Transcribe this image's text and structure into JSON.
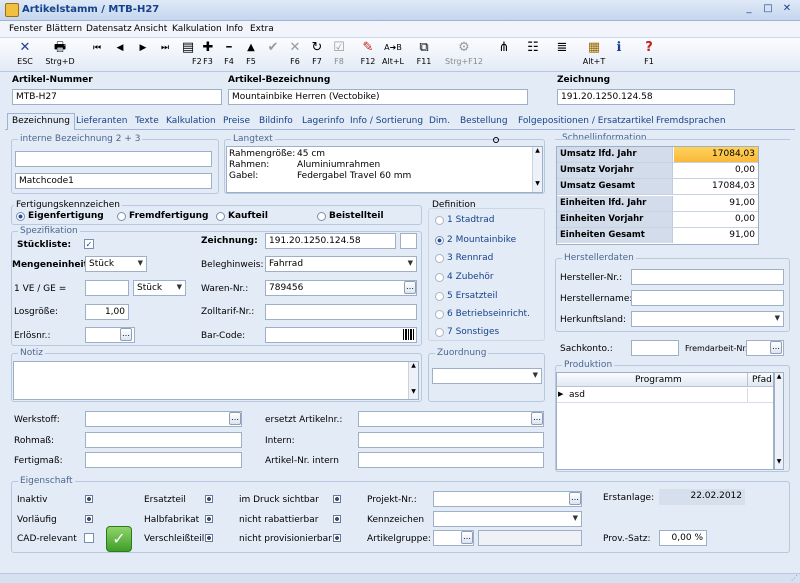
{
  "window": {
    "title": "Artikelstamm / MTB-H27",
    "buttons": [
      "_",
      "□",
      "✕"
    ]
  },
  "menu": [
    "Fenster",
    "Blättern",
    "Datensatz",
    "Ansicht",
    "Kalkulation",
    "Info",
    "Extra"
  ],
  "toolbar": [
    {
      "icon": "✕",
      "key": "ESC"
    },
    {
      "icon": "🖶",
      "key": "Strg+D"
    },
    {
      "icon": "⏮",
      "key": ""
    },
    {
      "icon": "◀",
      "key": ""
    },
    {
      "icon": "▶",
      "key": ""
    },
    {
      "icon": "⏭",
      "key": ""
    },
    {
      "icon": "▤",
      "key": "F2"
    },
    {
      "icon": "✚",
      "key": "F3"
    },
    {
      "icon": "━",
      "key": "F4"
    },
    {
      "icon": "▲",
      "key": "F5"
    },
    {
      "icon": "✔",
      "key": ""
    },
    {
      "icon": "✕",
      "key": "F6"
    },
    {
      "icon": "↻",
      "key": "F7"
    },
    {
      "icon": "☑",
      "key": "F8"
    },
    {
      "icon": "✎",
      "key": "F12"
    },
    {
      "icon": "A➜B",
      "key": "Alt+L"
    },
    {
      "icon": "⧉",
      "key": "F11"
    },
    {
      "icon": "⚙",
      "key": "Strg+F12"
    },
    {
      "icon": "⋔",
      "key": ""
    },
    {
      "icon": "☷",
      "key": ""
    },
    {
      "icon": "≣",
      "key": ""
    },
    {
      "icon": "▦",
      "key": "Alt+T"
    },
    {
      "icon": "ℹ",
      "key": ""
    },
    {
      "icon": "?",
      "key": "F1"
    }
  ],
  "header": {
    "nr_label": "Artikel-Nummer",
    "nr_value": "MTB-H27",
    "bez_label": "Artikel-Bezeichnung",
    "bez_value": "Mountainbike Herren (Vectobike)",
    "zeich_label": "Zeichnung",
    "zeich_value": "191.20.1250.124.58"
  },
  "tabs": [
    "Bezeichnung",
    "Lieferanten",
    "Texte",
    "Kalkulation",
    "Preise",
    "Bildinfo",
    "Lagerinfo",
    "Info / Sortierung",
    "Dim.",
    "Bestellung",
    "Folgepositionen / Ersatzartikel",
    "Fremdsprachen"
  ],
  "interne": {
    "title": "interne Bezeichnung 2 + 3",
    "line1": "",
    "line2": "Matchcode1"
  },
  "langtext": {
    "title": "Langtext",
    "lines": [
      {
        "k": "Rahmengröße:",
        "v": "45 cm"
      },
      {
        "k": "Rahmen:",
        "v": "Aluminiumrahmen"
      },
      {
        "k": "Gabel:",
        "v": "Federgabel Travel 60 mm"
      }
    ]
  },
  "fertigung": {
    "title": "Fertigungskennzeichen",
    "options": [
      "Eigenfertigung",
      "Fremdfertigung",
      "Kaufteil",
      "Beistellteil"
    ]
  },
  "definition": {
    "title": "Definition",
    "options": [
      "1 Stadtrad",
      "2 Mountainbike",
      "3 Rennrad",
      "4 Zubehör",
      "5 Ersatzteil",
      "6 Betriebseinricht.",
      "7 Sonstiges"
    ]
  },
  "spez": {
    "title": "Spezifikation",
    "stueckliste": "Stückliste:",
    "stueckliste_check": "✓",
    "mengeneinheit": "Mengeneinheit:",
    "mengeneinheit_value": "Stück",
    "ve": "1 VE / GE =",
    "ve_value": "",
    "ve_unit": "Stück",
    "losgroesse": "Losgröße:",
    "losgroesse_value": "1,00",
    "erloesnr": "Erlösnr.:",
    "zeichnung": "Zeichnung:",
    "zeichnung_value": "191.20.1250.124.58",
    "beleghinweis": "Beleghinweis:",
    "beleghinweis_value": "Fahrrad",
    "warennr": "Waren-Nr.:",
    "warennr_value": "789456",
    "zolltarif": "Zolltarif-Nr.:",
    "zolltarif_value": "",
    "barcode": "Bar-Code:",
    "barcode_value": ""
  },
  "notiz": {
    "title": "Notiz"
  },
  "zuordnung": {
    "title": "Zuordnung"
  },
  "lower": {
    "werkstoff": "Werkstoff:",
    "rohmass": "Rohmaß:",
    "fertigmass": "Fertigmaß:",
    "ersetzt": "ersetzt Artikelnr.:",
    "intern": "Intern:",
    "artnr_intern": "Artikel-Nr. intern"
  },
  "schnell": {
    "title": "Schnellinformation",
    "rows": [
      {
        "k": "Umsatz lfd. Jahr",
        "v": "17084,03"
      },
      {
        "k": "Umsatz Vorjahr",
        "v": "0,00"
      },
      {
        "k": "Umsatz Gesamt",
        "v": "17084,03"
      },
      {
        "k": "Einheiten lfd. Jahr",
        "v": "91,00"
      },
      {
        "k": "Einheiten Vorjahr",
        "v": "0,00"
      },
      {
        "k": "Einheiten Gesamt",
        "v": "91,00"
      }
    ]
  },
  "hersteller": {
    "title": "Herstellerdaten",
    "nr": "Hersteller-Nr.:",
    "name": "Herstellername:",
    "land": "Herkunftsland:"
  },
  "sachkonto": {
    "label": "Sachkonto.:",
    "fremd": "Fremdarbeit-Nr.:"
  },
  "produktion": {
    "title": "Produktion",
    "col1": "Programm",
    "col2": "Pfad",
    "row1": "asd"
  },
  "eigenschaft": {
    "title": "Eigenschaft",
    "c1": [
      "Inaktiv",
      "Vorläufig",
      "CAD-relevant"
    ],
    "c2": [
      "Ersatzteil",
      "Halbfabrikat",
      "Verschleißteil"
    ],
    "c3": [
      "im Druck sichtbar",
      "nicht rabattierbar",
      "nicht provisionierbar"
    ],
    "projekt": "Projekt-Nr.:",
    "kennzeichen": "Kennzeichen",
    "artikelgruppe": "Artikelgruppe:",
    "erstanlage": "Erstanlage:",
    "erstanlage_value": "22.02.2012",
    "prov": "Prov.-Satz:",
    "prov_value": "0,00 %"
  }
}
